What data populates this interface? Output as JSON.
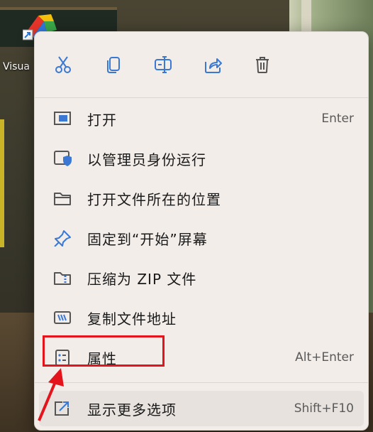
{
  "desktop": {
    "icon_label": "Visua"
  },
  "toolbar": {
    "buttons": [
      {
        "name": "cut-icon"
      },
      {
        "name": "copy-icon"
      },
      {
        "name": "rename-icon"
      },
      {
        "name": "share-icon"
      },
      {
        "name": "delete-icon"
      }
    ]
  },
  "menu": {
    "items": [
      {
        "label": "打开",
        "shortcut": "Enter",
        "icon": "open-window-icon"
      },
      {
        "label": "以管理员身份运行",
        "shortcut": "",
        "icon": "admin-shield-icon"
      },
      {
        "label": "打开文件所在的位置",
        "shortcut": "",
        "icon": "folder-icon"
      },
      {
        "label": "固定到“开始”屏幕",
        "shortcut": "",
        "icon": "pin-icon"
      },
      {
        "label": "压缩为 ZIP 文件",
        "shortcut": "",
        "icon": "zip-icon"
      },
      {
        "label": "复制文件地址",
        "shortcut": "",
        "icon": "copy-path-icon"
      },
      {
        "label": "属性",
        "shortcut": "Alt+Enter",
        "icon": "properties-icon"
      },
      {
        "label": "显示更多选项",
        "shortcut": "Shift+F10",
        "icon": "more-options-icon"
      }
    ]
  },
  "colors": {
    "accent": "#3a78d4",
    "annotation": "#e4141c"
  }
}
